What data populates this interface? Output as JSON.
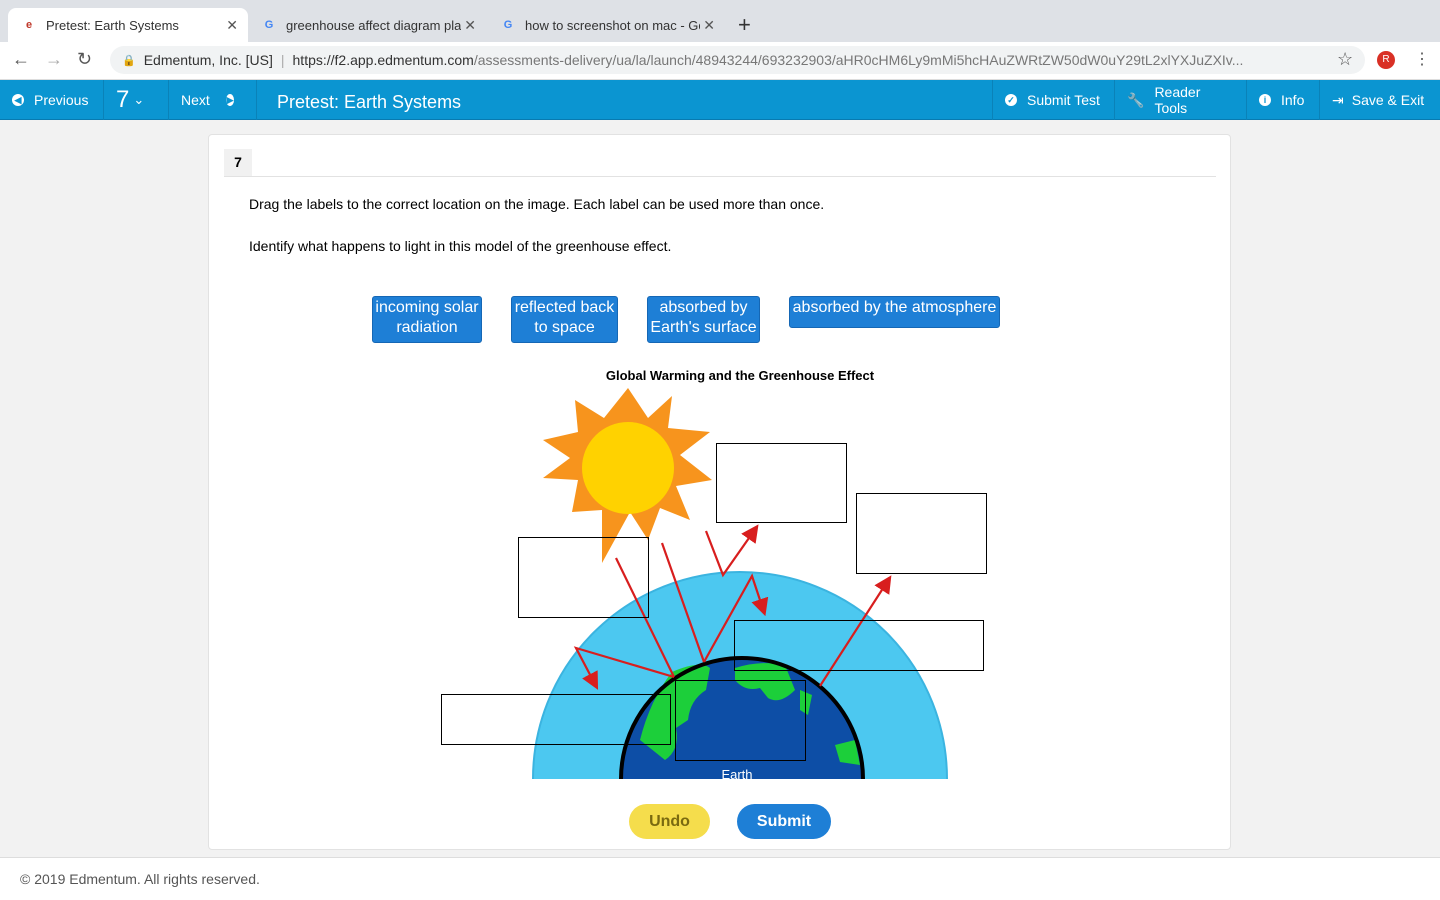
{
  "browser": {
    "tabs": [
      {
        "title": "Pretest: Earth Systems"
      },
      {
        "title": "greenhouse affect diagram pla"
      },
      {
        "title": "how to screenshot on mac - Go"
      }
    ],
    "site_identity": "Edmentum, Inc. [US]",
    "url_host": "https://f2.app.edmentum.com",
    "url_path": "/assessments-delivery/ua/la/launch/48943244/693232903/aHR0cHM6Ly9mMi5hcHAuZWRtZW50dW0uY29tL2xlYXJuZXIv...",
    "profile_initial": "R"
  },
  "toolbar": {
    "previous": "Previous",
    "question_number": "7",
    "next": "Next",
    "title": "Pretest: Earth Systems",
    "submit_test": "Submit Test",
    "reader_tools": "Reader Tools",
    "info": "Info",
    "save_exit": "Save & Exit"
  },
  "question": {
    "number": "7",
    "instruction": "Drag the labels to the correct location on the image. Each label can be used more than once.",
    "prompt": "Identify what happens to light in this model of the greenhouse effect.",
    "labels": [
      "incoming solar radiation",
      "reflected back to space",
      "absorbed by Earth's surface",
      "absorbed by the atmosphere"
    ],
    "diagram_title": "Global Warming and the Greenhouse Effect",
    "earth_label": "Earth",
    "undo": "Undo",
    "submit": "Submit"
  },
  "footer": {
    "copyright": "© 2019 Edmentum. All rights reserved."
  },
  "colors": {
    "nav": "#0b95d1",
    "label": "#1e7fd6",
    "undo": "#f5dd4c",
    "atmosphere": "#4cc8f0",
    "ocean": "#0d4ea6",
    "land": "#1ccf3a",
    "arrow": "#d81e1e",
    "sun_core": "#ffd200",
    "sun_rays": "#f7941d"
  }
}
